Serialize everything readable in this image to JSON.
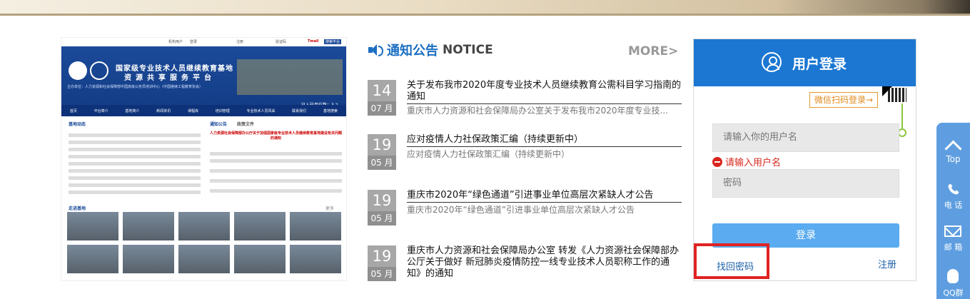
{
  "portal_image": {
    "top_links": [
      "机构用户",
      "登录",
      "注册",
      "验证码",
      "Tmall",
      "搜索平台"
    ],
    "title_line1": "国家级专业技术人员继续教育基地",
    "title_line2": "资源共享服务平台",
    "subtitle": "主办单位：人力资源和社会保障部中国高级公务员培训中心（中国继续工程教育协会）",
    "visitor_label": "已入驻单位数：",
    "visitor_count": "3 2",
    "nav_items": [
      "首页",
      "平台简介",
      "基地简介",
      "新闻资讯",
      "课程库",
      "培训管理",
      "专业技术人员风采",
      "联系我们",
      "基地搜索"
    ],
    "col1_head": "基地动态",
    "col2_head": "通知公告",
    "col3_head": "政策文件",
    "news_headline": "人力资源社会保障部办公厅关于加强国家级专业技术人员继续教育基地建设有关问题的通知",
    "gallery_head": "走进基地",
    "gallery_more": "更多"
  },
  "notices": {
    "title_cn": "通知公告",
    "title_en": "NOTICE",
    "more": "MORE>",
    "items": [
      {
        "day": "14",
        "month": "07 月",
        "title": "关于发布我市2020年度专业技术人员继续教育公需科目学习指南的通知",
        "desc": "重庆市人力资源和社会保障局办公室关于发布我市2020年度专业技..."
      },
      {
        "day": "19",
        "month": "05 月",
        "title": "应对疫情人力社保政策汇编（持续更新中）",
        "desc": "应对疫情人力社保政策汇编（持续更新中）"
      },
      {
        "day": "19",
        "month": "05 月",
        "title": "重庆市2020年“绿色通道”引进事业单位高层次紧缺人才公告",
        "desc": "重庆市2020年“绿色通道”引进事业单位高层次紧缺人才公告"
      },
      {
        "day": "19",
        "month": "05 月",
        "title": "重庆市人力资源和社会保障局办公室 转发《人力资源社会保障部办公厅关于做好 新冠肺炎疫情防控一线专业技术人员职称工作的通知》的通知",
        "desc": ""
      }
    ]
  },
  "login": {
    "title": "用户登录",
    "wechat_login": "微信扫码登录→",
    "username_placeholder": "请输入你的用户名",
    "error": "请输入用户名",
    "password_placeholder": "密码",
    "login_button": "登录",
    "forgot_password": "找回密码",
    "register": "注册"
  },
  "side_tools": {
    "top": "Top",
    "phone": "电 话",
    "mail": "邮 箱",
    "qq": "QQ群"
  },
  "colors": {
    "brand_blue": "#1b77d2",
    "notice_blue": "#1b6fc2",
    "error_red": "#d9251d",
    "highlight_red": "#e02222",
    "side_blue": "#5e9ee0"
  }
}
